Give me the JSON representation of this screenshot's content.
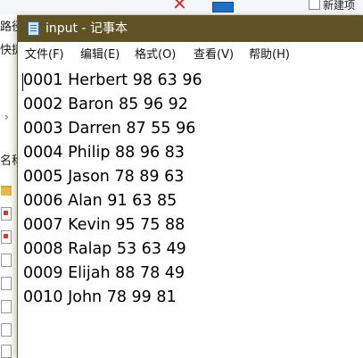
{
  "background_explorer": {
    "new_item_label": "新建项",
    "sidebar_fragments": [
      "路径",
      "快捷",
      "名称"
    ]
  },
  "window": {
    "title": "input - 记事本",
    "icon": "notepad-icon"
  },
  "menu": {
    "items": [
      {
        "label": "文件(F)"
      },
      {
        "label": "编辑(E)"
      },
      {
        "label": "格式(O)"
      },
      {
        "label": "查看(V)"
      },
      {
        "label": "帮助(H)"
      }
    ]
  },
  "editor": {
    "lines": [
      "0001 Herbert 98 63 96",
      "0002 Baron 85 96 92",
      "0003 Darren 87 55 96",
      "0004 Philip 88 96 83",
      "0005 Jason 78 89 63",
      "0006 Alan 91 63 85",
      "0007 Kevin 95 75 88",
      "0008 Ralap 53 63 49",
      "0009 Elijah 88 78 49",
      "0010 John 78 99 81"
    ]
  },
  "colors": {
    "titlebar": "#5f5223",
    "title_text": "#ffffff"
  }
}
